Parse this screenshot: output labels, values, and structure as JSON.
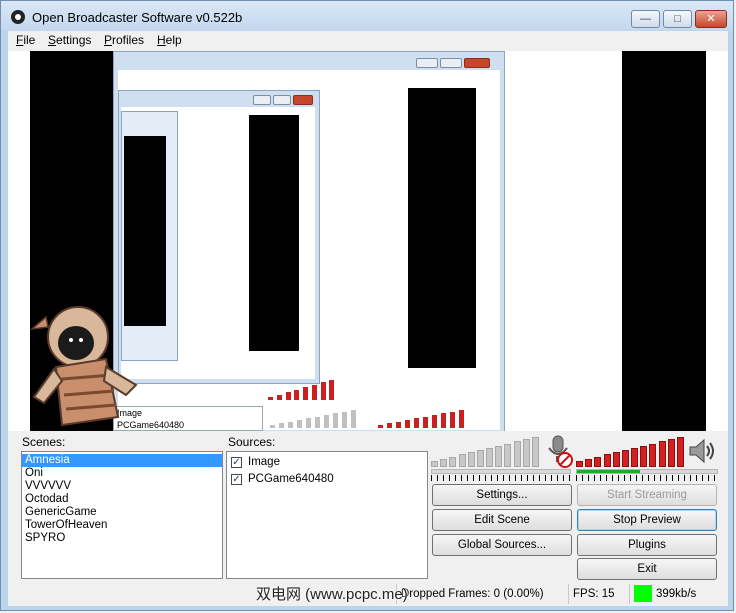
{
  "window": {
    "title": "Open Broadcaster Software v0.522b"
  },
  "title_buttons": {
    "minimize": "—",
    "maximize": "□",
    "close": "✕"
  },
  "menu": [
    {
      "label": "File"
    },
    {
      "label": "Settings"
    },
    {
      "label": "Profiles"
    },
    {
      "label": "Help"
    }
  ],
  "nested_preview": {
    "sources": [
      "Image",
      "PCGame640480"
    ]
  },
  "scenes": {
    "label": "Scenes:",
    "items": [
      "Amnesia",
      "Oni",
      "VVVVVV",
      "Octodad",
      "GenericGame",
      "TowerOfHeaven",
      "SPYRO"
    ],
    "selected": "Amnesia"
  },
  "sources": {
    "label": "Sources:",
    "items": [
      {
        "name": "Image",
        "checked": true
      },
      {
        "name": "PCGame640480",
        "checked": true
      }
    ]
  },
  "audio": {
    "mic_muted": true,
    "desktop_level": 0.45
  },
  "buttons": {
    "settings": "Settings...",
    "start_streaming": "Start Streaming",
    "edit_scene": "Edit Scene",
    "stop_preview": "Stop Preview",
    "global_sources": "Global Sources...",
    "plugins": "Plugins",
    "exit": "Exit"
  },
  "status": {
    "watermark": "双电网 (www.pcpc.me)",
    "dropped_frames": "Dropped Frames: 0 (0.00%)",
    "fps": "FPS: 15",
    "bitrate": "399kb/s",
    "bitrate_color": "#00ff00"
  }
}
